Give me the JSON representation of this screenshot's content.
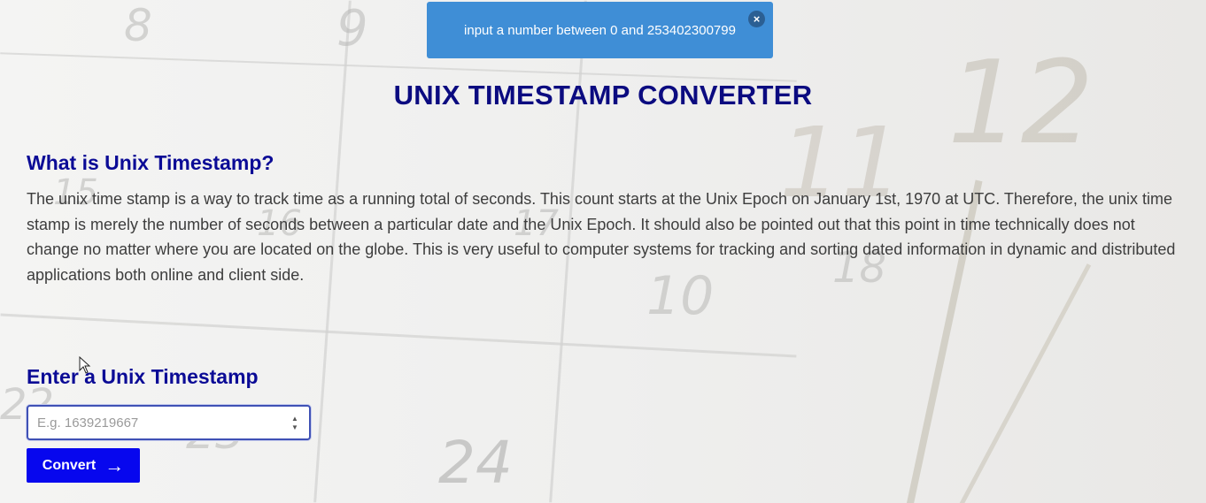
{
  "toast": {
    "message": "input a number between 0 and 253402300799",
    "close_icon": "×"
  },
  "page_title": "UNIX TIMESTAMP CONVERTER",
  "about": {
    "heading": "What is Unix Timestamp?",
    "body": "The unix time stamp is a way to track time as a running total of seconds. This count starts at the Unix Epoch on January 1st, 1970 at UTC. Therefore, the unix time stamp is merely the number of seconds between a particular date and the Unix Epoch. It should also be pointed out that this point in time technically does not change no matter where you are located on the globe. This is very useful to computer systems for tracking and sorting dated information in dynamic and distributed applications both online and client side."
  },
  "converter": {
    "heading": "Enter a Unix Timestamp",
    "input_placeholder": "E.g. 1639219667",
    "input_value": "",
    "convert_label": "Convert",
    "arrow_icon": "→",
    "spinner_up": "▲",
    "spinner_down": "▼"
  },
  "background": {
    "numbers": [
      "8",
      "9",
      "11",
      "12",
      "15",
      "16",
      "17",
      "18",
      "10",
      "22",
      "23",
      "24"
    ]
  },
  "colors": {
    "toast_bg": "#3f8ed6",
    "heading": "#0b0b80",
    "button_bg": "#0707ee"
  }
}
